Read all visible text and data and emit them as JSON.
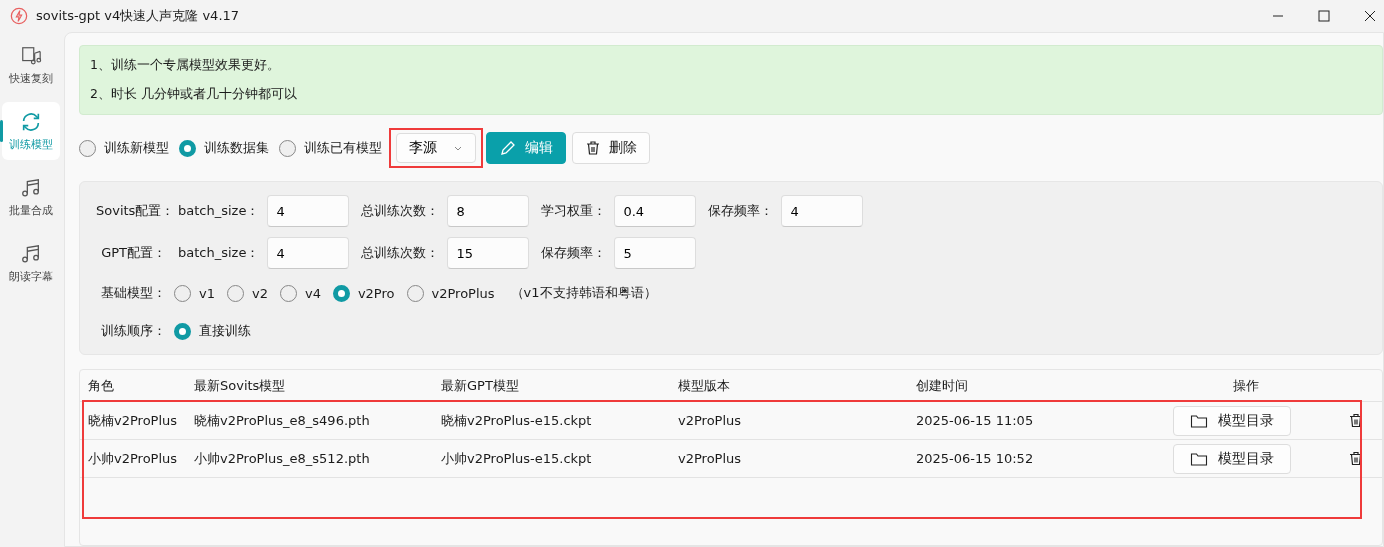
{
  "window": {
    "title": "sovits-gpt v4快速人声克隆 v4.17"
  },
  "sidebar": {
    "items": [
      {
        "label": "快速复刻",
        "kind": "sheet",
        "selected": false
      },
      {
        "label": "训练模型",
        "kind": "sync",
        "selected": true
      },
      {
        "label": "批量合成",
        "kind": "note",
        "selected": false
      },
      {
        "label": "朗读字幕",
        "kind": "note",
        "selected": false
      }
    ]
  },
  "tips": [
    "1、训练一个专属模型效果更好。",
    "2、时长 几分钟或者几十分钟都可以"
  ],
  "mode": {
    "options": [
      {
        "label": "训练新模型",
        "selected": false
      },
      {
        "label": "训练数据集",
        "selected": true
      },
      {
        "label": "训练已有模型",
        "selected": false
      }
    ],
    "dropdown": {
      "value": "李源",
      "highlighted": true
    },
    "edit_button": "编辑",
    "delete_button": "删除"
  },
  "config": {
    "rows": [
      {
        "label": "Sovits配置：",
        "fields": [
          {
            "label": "batch_size：",
            "value": "4"
          },
          {
            "label": "总训练次数：",
            "value": "8"
          },
          {
            "label": "学习权重：",
            "value": "0.4"
          },
          {
            "label": "保存频率：",
            "value": "4"
          }
        ]
      },
      {
        "label": "GPT配置：",
        "fields": [
          {
            "label": "batch_size：",
            "value": "4"
          },
          {
            "label": "总训练次数：",
            "value": "15"
          },
          {
            "label": "保存频率：",
            "value": "5"
          }
        ]
      }
    ],
    "base_model": {
      "label": "基础模型：",
      "options": [
        {
          "label": "v1",
          "selected": false
        },
        {
          "label": "v2",
          "selected": false
        },
        {
          "label": "v4",
          "selected": false
        },
        {
          "label": "v2Pro",
          "selected": true
        },
        {
          "label": "v2ProPlus",
          "selected": false
        }
      ],
      "note": "（v1不支持韩语和粤语）"
    },
    "order": {
      "label": "训练顺序：",
      "options": [
        {
          "label": "直接训练",
          "selected": true
        }
      ]
    }
  },
  "table": {
    "highlighted": true,
    "columns": [
      "角色",
      "最新Sovits模型",
      "最新GPT模型",
      "模型版本",
      "创建时间",
      "操作"
    ],
    "rows": [
      {
        "cells": [
          "晓楠v2ProPlus",
          "晓楠v2ProPlus_e8_s496.pth",
          "晓楠v2ProPlus-e15.ckpt",
          "v2ProPlus",
          "2025-06-15 11:05"
        ],
        "button": "模型目录"
      },
      {
        "cells": [
          "小帅v2ProPlus",
          "小帅v2ProPlus_e8_s512.pth",
          "小帅v2ProPlus-e15.ckpt",
          "v2ProPlus",
          "2025-06-15 10:52"
        ],
        "button": "模型目录"
      }
    ]
  }
}
